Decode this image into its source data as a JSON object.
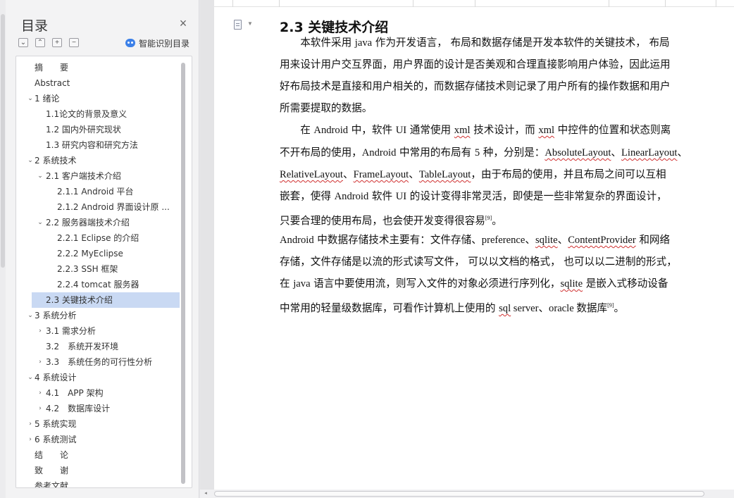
{
  "nav": {
    "title": "目录",
    "close_glyph": "×",
    "tools": {
      "expand_glyph": "⌄",
      "collapse_glyph": "⌃",
      "add_glyph": "+",
      "remove_glyph": "−"
    },
    "smart_toc_label": "智能识别目录",
    "toc": [
      {
        "label": "摘　　要",
        "level": 0,
        "arrow": ""
      },
      {
        "label": "Abstract",
        "level": 0,
        "arrow": ""
      },
      {
        "label": "1 绪论",
        "level": 0,
        "arrow": "⌄"
      },
      {
        "label": "1.1论文的背景及意义",
        "level": 1,
        "arrow": ""
      },
      {
        "label": "1.2 国内外研究现状",
        "level": 1,
        "arrow": ""
      },
      {
        "label": "1.3  研究内容和研究方法",
        "level": 1,
        "arrow": ""
      },
      {
        "label": "2 系统技术",
        "level": 0,
        "arrow": "⌄"
      },
      {
        "label": "2.1 客户端技术介绍",
        "level": 1,
        "arrow": "⌄"
      },
      {
        "label": "2.1.1 Android  平台",
        "level": 2,
        "arrow": ""
      },
      {
        "label": "2.1.2 Android  界面设计原 ...",
        "level": 2,
        "arrow": ""
      },
      {
        "label": "2.2 服务器端技术介绍",
        "level": 1,
        "arrow": "⌄"
      },
      {
        "label": "2.2.1 Eclipse  的介绍",
        "level": 2,
        "arrow": ""
      },
      {
        "label": "2.2.2 MyEclipse",
        "level": 2,
        "arrow": ""
      },
      {
        "label": "2.2.3 SSH  框架",
        "level": 2,
        "arrow": ""
      },
      {
        "label": "2.2.4 tomcat  服务器",
        "level": 2,
        "arrow": ""
      },
      {
        "label": "2.3  关键技术介绍",
        "level": 1,
        "arrow": "",
        "active": true
      },
      {
        "label": "3 系统分析",
        "level": 0,
        "arrow": "⌄"
      },
      {
        "label": "3.1 需求分析",
        "level": 1,
        "arrow": "›"
      },
      {
        "label": "3.2　系统开发环境",
        "level": 1,
        "arrow": ""
      },
      {
        "label": "3.3　系统任务的可行性分析",
        "level": 1,
        "arrow": "›"
      },
      {
        "label": "4 系统设计",
        "level": 0,
        "arrow": "⌄"
      },
      {
        "label": "4.1　APP 架构",
        "level": 1,
        "arrow": "›"
      },
      {
        "label": "4.2　数据库设计",
        "level": 1,
        "arrow": "›"
      },
      {
        "label": "5 系统实现",
        "level": 0,
        "arrow": "›"
      },
      {
        "label": "6 系统测试",
        "level": 0,
        "arrow": "›"
      },
      {
        "label": "结　　论",
        "level": 0,
        "arrow": ""
      },
      {
        "label": "致　　谢",
        "level": 0,
        "arrow": ""
      },
      {
        "label": "参考文献",
        "level": 0,
        "arrow": ""
      }
    ]
  },
  "doc": {
    "heading": "2.3  关键技术介绍",
    "lines": [
      [
        {
          "t": "　　本软件采用 "
        },
        {
          "t": "java",
          "en": true
        },
        {
          "t": " 作为开发语言，  布局和数据存储是开发本软件的关键技术，  布局"
        }
      ],
      [
        {
          "t": "用来设计用户交互界面，用户界面的设计是否美观和合理直接影响用户体验，因此运用"
        }
      ],
      [
        {
          "t": "好布局技术是直接和用户相关的，而数据存储技术则记录了用户所有的操作数据和用户"
        }
      ],
      [
        {
          "t": "所需要提取的数据。"
        }
      ],
      [
        {
          "t": "　　在 "
        },
        {
          "t": "Android",
          "en": true
        },
        {
          "t": " 中，软件 "
        },
        {
          "t": "UI",
          "en": true
        },
        {
          "t": " 通常使用 "
        },
        {
          "t": "xml",
          "en": true,
          "wavy": true
        },
        {
          "t": " 技术设计，而 "
        },
        {
          "t": "xml",
          "en": true,
          "wavy": true
        },
        {
          "t": " 中控件的位置和状态则离"
        }
      ],
      [
        {
          "t": "不开布局的使用，"
        },
        {
          "t": "Android",
          "en": true
        },
        {
          "t": " 中常用的布局有 "
        },
        {
          "t": "5",
          "en": true
        },
        {
          "t": " 种，分别是："
        },
        {
          "t": "AbsoluteLayout",
          "en": true,
          "wavy": true
        },
        {
          "t": "、"
        },
        {
          "t": "LinearLayout",
          "en": true,
          "wavy": true
        },
        {
          "t": "、"
        }
      ],
      [
        {
          "t": "RelativeLayout",
          "en": true,
          "wavy": true
        },
        {
          "t": "、"
        },
        {
          "t": "FrameLayout",
          "en": true,
          "wavy": true
        },
        {
          "t": "、"
        },
        {
          "t": "TableLayout",
          "en": true,
          "wavy": true
        },
        {
          "t": "，由于布局的使用，并且布局之间可以互相"
        }
      ],
      [
        {
          "t": "嵌套，使得 "
        },
        {
          "t": "Android",
          "en": true
        },
        {
          "t": " 软件 "
        },
        {
          "t": "UI",
          "en": true
        },
        {
          "t": " 的设计变得非常灵活，即使是一些非常复杂的界面设计，"
        }
      ],
      [
        {
          "t": "只要合理的使用布局，也会使开发变得很容易"
        },
        {
          "t": "[9]",
          "sup": true
        },
        {
          "t": "。"
        }
      ],
      [
        {
          "t": "Android",
          "en": true
        },
        {
          "t": " 中数据存储技术主要有：文件存储、"
        },
        {
          "t": "preference",
          "en": true
        },
        {
          "t": "、"
        },
        {
          "t": "sqlite",
          "en": true,
          "wavy": true
        },
        {
          "t": "、"
        },
        {
          "t": "ContentProvider",
          "en": true,
          "wavy": true
        },
        {
          "t": " 和网络"
        }
      ],
      [
        {
          "t": "存储，文件存储是以流的形式读写文件，  可以以文档的格式，  也可以以二进制的形式，"
        }
      ],
      [
        {
          "t": "在 "
        },
        {
          "t": "java",
          "en": true
        },
        {
          "t": " 语言中要使用流，则写入文件的对象必须进行序列化，"
        },
        {
          "t": "sqlite",
          "en": true,
          "wavy": true
        },
        {
          "t": " 是嵌入式移动设备"
        }
      ],
      [
        {
          "t": "中常用的轻量级数据库，可看作计算机上使用的 "
        },
        {
          "t": "sql",
          "en": true,
          "wavy": true
        },
        {
          "t": " server、oracle 数据库",
          "en": true
        },
        {
          "t": "[9]",
          "sup": true
        },
        {
          "t": "。"
        }
      ]
    ]
  },
  "scroll": {
    "left_glyph": "◂"
  }
}
